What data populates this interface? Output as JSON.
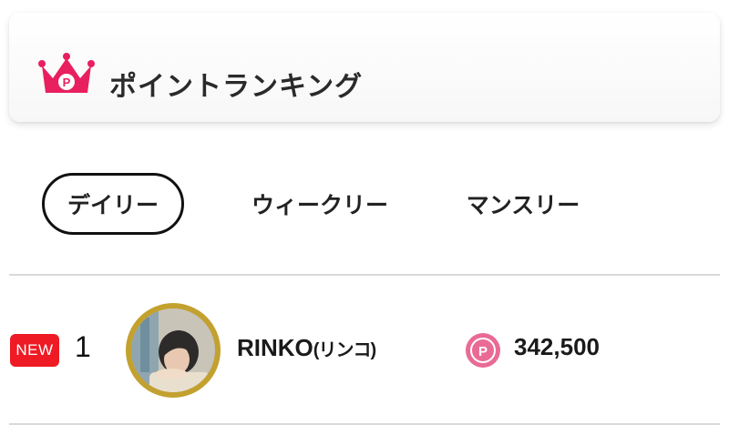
{
  "header": {
    "title": "ポイントランキング",
    "icon": "crown-point-icon",
    "icon_color": "#e8205f"
  },
  "tabs": [
    {
      "label": "デイリー",
      "active": true
    },
    {
      "label": "ウィークリー",
      "active": false
    },
    {
      "label": "マンスリー",
      "active": false
    }
  ],
  "ranking": [
    {
      "badge": "NEW",
      "rank": "1",
      "name": "RINKO",
      "name_kana": "(リンコ)",
      "points": "342,500",
      "point_icon_letter": "P",
      "badge_color": "#ee1b24",
      "point_icon_color": "#e96b95",
      "avatar_ring_color": "#c3a12f"
    }
  ]
}
